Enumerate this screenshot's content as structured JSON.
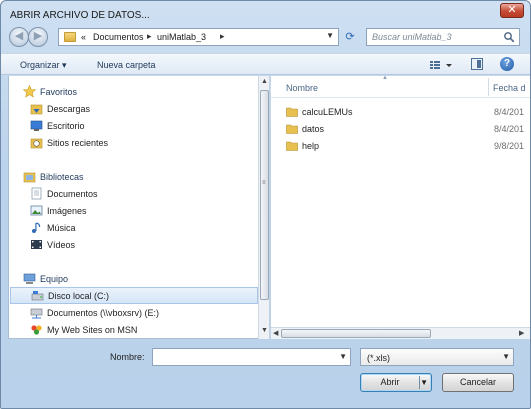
{
  "window": {
    "title": "ABRIR ARCHIVO DE DATOS..."
  },
  "address": {
    "overflow": "«",
    "crumbs": [
      "Documentos",
      "uniMatlab_3"
    ],
    "separator": "▸"
  },
  "search": {
    "placeholder": "Buscar uniMatlab_3"
  },
  "toolbar": {
    "organize_label": "Organizar ▾",
    "new_folder_label": "Nueva carpeta"
  },
  "nav": {
    "favorites": {
      "label": "Favoritos",
      "items": [
        "Descargas",
        "Escritorio",
        "Sitios recientes"
      ]
    },
    "libraries": {
      "label": "Bibliotecas",
      "items": [
        "Documentos",
        "Imágenes",
        "Música",
        "Vídeos"
      ]
    },
    "computer": {
      "label": "Equipo",
      "items": [
        "Disco local (C:)",
        "Documentos (\\\\vboxsrv) (E:)",
        "My Web Sites on MSN"
      ]
    },
    "selected": "Disco local (C:)"
  },
  "files": {
    "columns": {
      "name": "Nombre",
      "date": "Fecha d"
    },
    "rows": [
      {
        "name": "calcuLEMUs",
        "date": "8/4/201"
      },
      {
        "name": "datos",
        "date": "8/4/201"
      },
      {
        "name": "help",
        "date": "9/8/201"
      }
    ]
  },
  "bottom": {
    "name_label": "Nombre:",
    "name_value": "",
    "filter_value": "(*.xls)",
    "open_label": "Abrir",
    "cancel_label": "Cancelar"
  },
  "icons": {
    "close": "close-icon",
    "back": "back-arrow-icon",
    "forward": "forward-arrow-icon",
    "refresh": "refresh-icon",
    "search": "search-icon",
    "views": "views-icon",
    "preview": "preview-pane-icon",
    "help": "help-icon",
    "folder": "folder-icon"
  },
  "colors": {
    "accent": "#2e6bb3",
    "folder": "#e8c050",
    "selected": "#d6e6f7"
  }
}
